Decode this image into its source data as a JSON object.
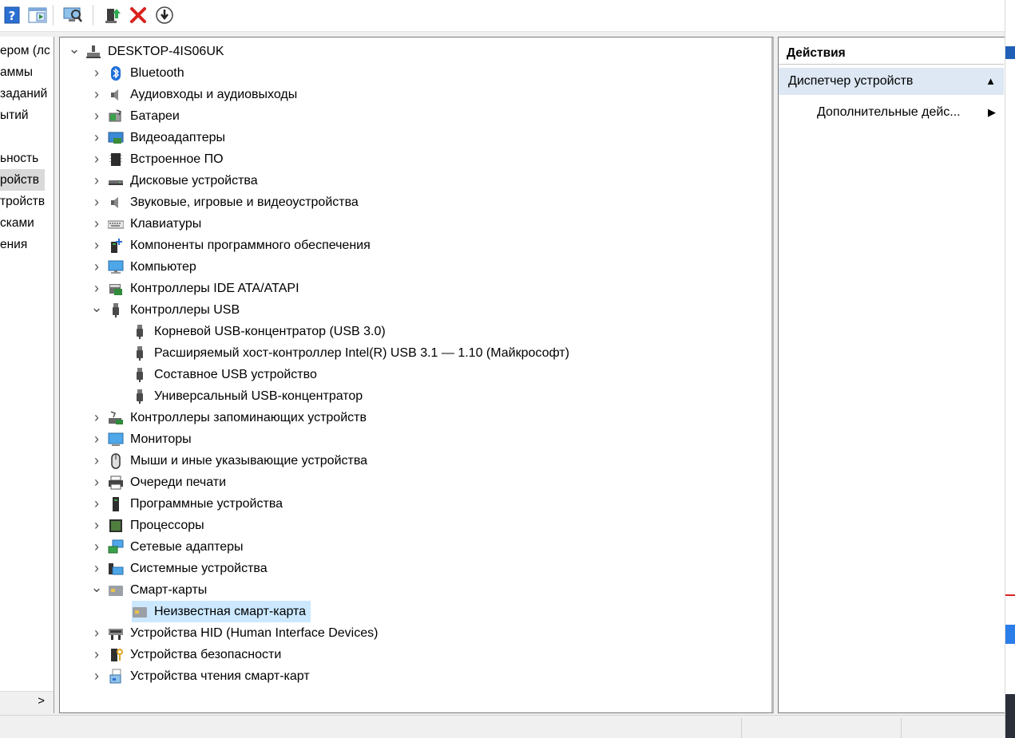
{
  "left_nav": {
    "items": [
      "ером (лс",
      "аммы",
      "заданий",
      "ытий",
      "",
      "ьность",
      "ройств",
      "тройств",
      "сками",
      "ения"
    ],
    "selected_index": 6,
    "scroll_right": ">"
  },
  "tree": {
    "root": "DESKTOP-4IS06UK",
    "nodes": [
      {
        "label": "Bluetooth",
        "icon": "bluetooth-icon",
        "expanded": false
      },
      {
        "label": "Аудиовходы и аудиовыходы",
        "icon": "speaker-icon",
        "expanded": false
      },
      {
        "label": "Батареи",
        "icon": "battery-icon",
        "expanded": false
      },
      {
        "label": "Видеоадаптеры",
        "icon": "display-adapter-icon",
        "expanded": false
      },
      {
        "label": "Встроенное ПО",
        "icon": "firmware-icon",
        "expanded": false
      },
      {
        "label": "Дисковые устройства",
        "icon": "disk-drive-icon",
        "expanded": false
      },
      {
        "label": "Звуковые, игровые и видеоустройства",
        "icon": "speaker-icon",
        "expanded": false
      },
      {
        "label": "Клавиатуры",
        "icon": "keyboard-icon",
        "expanded": false
      },
      {
        "label": "Компоненты программного обеспечения",
        "icon": "software-component-icon",
        "expanded": false
      },
      {
        "label": "Компьютер",
        "icon": "computer-icon",
        "expanded": false
      },
      {
        "label": "Контроллеры IDE ATA/ATAPI",
        "icon": "ide-controller-icon",
        "expanded": false
      },
      {
        "label": "Контроллеры USB",
        "icon": "usb-icon",
        "expanded": true,
        "children": [
          "Корневой USB-концентратор (USB 3.0)",
          "Расширяемый хост-контроллер Intel(R) USB 3.1 — 1.10 (Майкрософт)",
          "Составное USB устройство",
          "Универсальный USB-концентратор"
        ]
      },
      {
        "label": "Контроллеры запоминающих устройств",
        "icon": "storage-controller-icon",
        "expanded": false
      },
      {
        "label": "Мониторы",
        "icon": "monitor-icon",
        "expanded": false
      },
      {
        "label": "Мыши и иные указывающие устройства",
        "icon": "mouse-icon",
        "expanded": false
      },
      {
        "label": "Очереди печати",
        "icon": "printer-icon",
        "expanded": false
      },
      {
        "label": "Программные устройства",
        "icon": "software-device-icon",
        "expanded": false
      },
      {
        "label": "Процессоры",
        "icon": "processor-icon",
        "expanded": false
      },
      {
        "label": "Сетевые адаптеры",
        "icon": "network-adapter-icon",
        "expanded": false
      },
      {
        "label": "Системные устройства",
        "icon": "system-device-icon",
        "expanded": false
      },
      {
        "label": "Смарт-карты",
        "icon": "smart-card-icon",
        "expanded": true,
        "children": [
          "Неизвестная смарт-карта"
        ],
        "selected_child": 0
      },
      {
        "label": "Устройства HID (Human Interface Devices)",
        "icon": "hid-icon",
        "expanded": false
      },
      {
        "label": "Устройства безопасности",
        "icon": "security-device-icon",
        "expanded": false
      },
      {
        "label": "Устройства чтения смарт-карт",
        "icon": "smart-card-reader-icon",
        "expanded": false
      }
    ]
  },
  "actions": {
    "title": "Действия",
    "section": "Диспетчер устройств",
    "more": "Дополнительные дейс..."
  },
  "toolbar": {
    "icons": [
      "help-icon",
      "view-pane-icon",
      "scan-hardware-icon",
      "update-driver-icon",
      "uninstall-icon",
      "disable-icon"
    ]
  },
  "colors": {
    "selection": "#cce8ff",
    "actions_header": "#dde8f4",
    "uninstall_red": "#d9211e"
  }
}
